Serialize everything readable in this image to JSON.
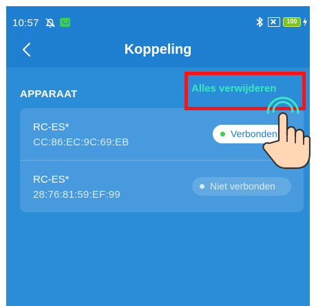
{
  "status_bar": {
    "time": "10:57",
    "battery": "100",
    "icons": [
      "mute-icon",
      "app-notification-icon",
      "bluetooth-icon",
      "nfc-icon",
      "battery-icon",
      "charging-icon"
    ]
  },
  "header": {
    "title": "Koppeling",
    "back_icon": "chevron-left-icon"
  },
  "section": {
    "title": "APPARAAT",
    "action_label": "Alles verwijderen"
  },
  "devices": [
    {
      "name": "RC-ES*",
      "mac": "CC:86:EC:9C:69:EB",
      "status": "Verbonden",
      "connected": true
    },
    {
      "name": "RC-ES*",
      "mac": "28:76:81:59:EF:99",
      "status": "Niet verbonden",
      "connected": false
    }
  ],
  "overlay": {
    "icon": "pointing-hand-icon"
  },
  "colors": {
    "background": "#2b8cd8",
    "header": "#1f7fd0",
    "accent": "#38e8c0",
    "highlight_box": "#ff1111",
    "connected_dot": "#3fcf4f"
  }
}
